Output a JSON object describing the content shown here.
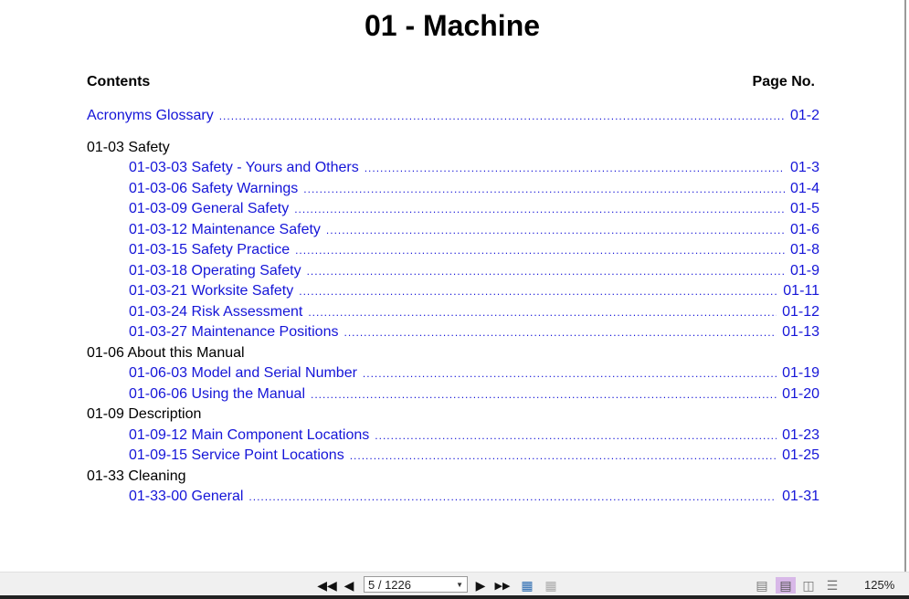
{
  "document": {
    "title": "01 - Machine",
    "contents_label": "Contents",
    "page_no_label": "Page No.",
    "top_entry": {
      "label": "Acronyms Glossary",
      "page": "01-2"
    },
    "sections": [
      {
        "title": "01-03 Safety",
        "entries": [
          {
            "label": "01-03-03 Safety - Yours and Others",
            "page": "01-3"
          },
          {
            "label": "01-03-06 Safety Warnings",
            "page": "01-4"
          },
          {
            "label": "01-03-09 General Safety",
            "page": "01-5"
          },
          {
            "label": "01-03-12 Maintenance Safety",
            "page": "01-6"
          },
          {
            "label": "01-03-15 Safety Practice",
            "page": "01-8"
          },
          {
            "label": "01-03-18 Operating Safety",
            "page": "01-9"
          },
          {
            "label": "01-03-21 Worksite Safety",
            "page": "01-11"
          },
          {
            "label": "01-03-24 Risk Assessment",
            "page": "01-12"
          },
          {
            "label": "01-03-27 Maintenance Positions",
            "page": "01-13"
          }
        ]
      },
      {
        "title": "01-06 About this Manual",
        "entries": [
          {
            "label": "01-06-03 Model and Serial Number",
            "page": "01-19"
          },
          {
            "label": "01-06-06 Using the Manual",
            "page": "01-20"
          }
        ]
      },
      {
        "title": "01-09 Description",
        "entries": [
          {
            "label": "01-09-12 Main Component Locations",
            "page": "01-23"
          },
          {
            "label": "01-09-15 Service Point Locations",
            "page": "01-25"
          }
        ]
      },
      {
        "title": "01-33 Cleaning",
        "entries": [
          {
            "label": "01-33-00 General",
            "page": "01-31"
          }
        ]
      }
    ]
  },
  "toolbar": {
    "page_indicator": "5 / 1226",
    "zoom": "125%",
    "icons": [
      "first-page-icon",
      "prev-page-icon",
      "next-page-icon",
      "last-page-icon",
      "copy-icon",
      "paste-icon",
      "single-page-icon",
      "continuous-page-icon",
      "two-page-icon",
      "two-page-continuous-icon"
    ]
  },
  "colors": {
    "link": "#1515d8",
    "selected_view": "#d8b8e8"
  }
}
